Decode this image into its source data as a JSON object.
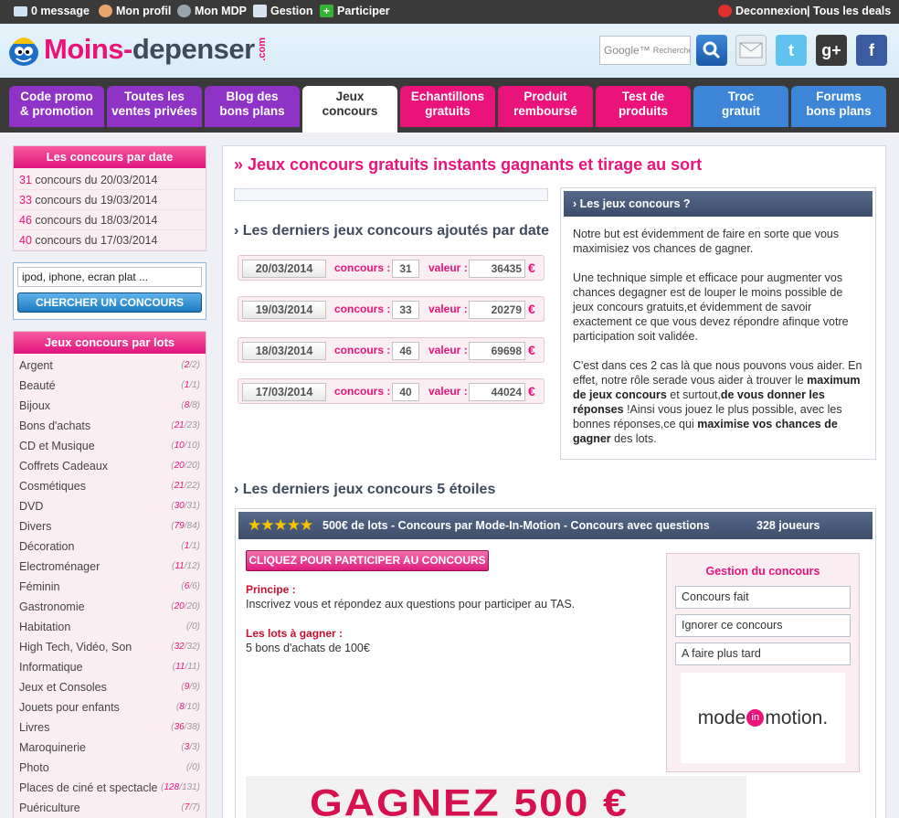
{
  "topbar": {
    "messages": "0 message",
    "profile": "Mon profil",
    "mdp": "Mon MDP",
    "gestion": "Gestion",
    "participer": "Participer",
    "logout": "Deconnexion",
    "sep": "|",
    "deals": "Tous les deals"
  },
  "logo": {
    "part1": "Moins-",
    "part2": "depenser",
    "suffix": ".com"
  },
  "google_search": {
    "brand": "Google™",
    "placeholder": "Recherche"
  },
  "social": [
    "search-button-icon",
    "mail-icon",
    "twitter-icon",
    "google-plus-icon",
    "facebook-icon"
  ],
  "nav": {
    "tabs": [
      {
        "line1": "Code promo",
        "line2": "& promotion",
        "color": "#8f33c6"
      },
      {
        "line1": "Toutes les",
        "line2": "ventes privées",
        "color": "#8f33c6"
      },
      {
        "line1": "Blog des",
        "line2": "bons plans",
        "color": "#8f33c6"
      },
      {
        "line1": "Jeux",
        "line2": "concours",
        "color": "#ffffff",
        "active": true
      },
      {
        "line1": "Echantillons",
        "line2": "gratuits",
        "color": "#e9137a"
      },
      {
        "line1": "Produit",
        "line2": "remboursé",
        "color": "#e9137a"
      },
      {
        "line1": "Test de",
        "line2": "produits",
        "color": "#e9137a"
      },
      {
        "line1": "Troc",
        "line2": "gratuit",
        "color": "#3d85d7"
      },
      {
        "line1": "Forums",
        "line2": "bons plans",
        "color": "#3d85d7"
      }
    ]
  },
  "sidebar": {
    "dates_title": "Les concours par date",
    "dates": [
      {
        "count": "31",
        "label": " concours du 20/03/2014"
      },
      {
        "count": "33",
        "label": " concours du 19/03/2014"
      },
      {
        "count": "46",
        "label": " concours du 18/03/2014"
      },
      {
        "count": "40",
        "label": " concours du 17/03/2014"
      }
    ],
    "search_value": "ipod, iphone, ecran plat ...",
    "search_button": "CHERCHER UN CONCOURS",
    "lots_title": "Jeux concours par lots",
    "lots": [
      {
        "name": "Argent",
        "a": "2",
        "b": "2"
      },
      {
        "name": "Beauté",
        "a": "1",
        "b": "1"
      },
      {
        "name": "Bijoux",
        "a": "8",
        "b": "8"
      },
      {
        "name": "Bons d'achats",
        "a": "21",
        "b": "23"
      },
      {
        "name": "CD et Musique",
        "a": "10",
        "b": "10"
      },
      {
        "name": "Coffrets Cadeaux",
        "a": "20",
        "b": "20"
      },
      {
        "name": "Cosmétiques",
        "a": "21",
        "b": "22"
      },
      {
        "name": "DVD",
        "a": "30",
        "b": "31"
      },
      {
        "name": "Divers",
        "a": "79",
        "b": "84"
      },
      {
        "name": "Décoration",
        "a": "1",
        "b": "1"
      },
      {
        "name": "Electroménager",
        "a": "11",
        "b": "12"
      },
      {
        "name": "Féminin",
        "a": "6",
        "b": "6"
      },
      {
        "name": "Gastronomie",
        "a": "20",
        "b": "20"
      },
      {
        "name": "Habitation",
        "a": "",
        "b": "0"
      },
      {
        "name": "High Tech, Vidéo, Son",
        "a": "32",
        "b": "32"
      },
      {
        "name": "Informatique",
        "a": "11",
        "b": "11"
      },
      {
        "name": "Jeux et Consoles",
        "a": "9",
        "b": "9"
      },
      {
        "name": "Jouets pour enfants",
        "a": "8",
        "b": "10"
      },
      {
        "name": "Livres",
        "a": "36",
        "b": "38"
      },
      {
        "name": "Maroquinerie",
        "a": "3",
        "b": "3"
      },
      {
        "name": "Photo",
        "a": "",
        "b": "0"
      },
      {
        "name": "Places de ciné et spectacle",
        "a": "128",
        "b": "131"
      },
      {
        "name": "Puériculture",
        "a": "7",
        "b": "7"
      }
    ]
  },
  "main": {
    "title": "Jeux concours gratuits instants gagnants et tirage au sort",
    "latest_title": "Les derniers jeux concours ajoutés par date",
    "concours_label": "concours :",
    "valeur_label": "valeur :",
    "euro": "€",
    "latest": [
      {
        "date": "20/03/2014",
        "count": "31",
        "value": "36435"
      },
      {
        "date": "19/03/2014",
        "count": "33",
        "value": "20279"
      },
      {
        "date": "18/03/2014",
        "count": "46",
        "value": "69698"
      },
      {
        "date": "17/03/2014",
        "count": "40",
        "value": "44024"
      }
    ],
    "info_title": "Les jeux concours ?",
    "info_p1": "Notre but est évidemment de faire en sorte que vous maximisiez vos chances de gagner.",
    "info_p2": "Une technique simple et efficace pour augmenter vos chances degagner est de louper le moins possible de jeux concours gratuits,et évidemment de savoir exactement ce que vous devez répondre afinque votre participation soit validée.",
    "info_p3a": "C'est dans ces 2 cas là que nous pouvons vous aider. En effet, notre rôle serade vous aider à trouver le ",
    "info_p3b": "maximum de jeux concours",
    "info_p3c": " et surtout,",
    "info_p3d": "de vous donner les réponses",
    "info_p3e": " !Ainsi vous jouez le plus possible, avec les bonnes réponses,ce qui ",
    "info_p3f": "maximise vos chances de gagner",
    "info_p3g": " des lots.",
    "stars_title": "Les derniers jeux concours 5 étoiles",
    "card": {
      "stars": "★★★★★",
      "rating": 5,
      "title": "500€ de lots - Concours par Mode-In-Motion - Concours avec questions",
      "players": "328 joueurs",
      "button": "CLIQUEZ POUR PARTICIPER AU CONCOURS",
      "principe_label": "Principe :",
      "principe": "Inscrivez vous et répondez aux questions pour participer au TAS.",
      "lots_label": "Les lots à gagner :",
      "lots": "5 bons d'achats de 100€",
      "gestion_title": "Gestion du concours",
      "btn_done": "Concours fait",
      "btn_ignore": "Ignorer ce concours",
      "btn_later": "A faire plus tard",
      "brand_a": "mode",
      "brand_in": "in",
      "brand_b": "motion.",
      "banner": "GAGNEZ 500 €"
    }
  }
}
